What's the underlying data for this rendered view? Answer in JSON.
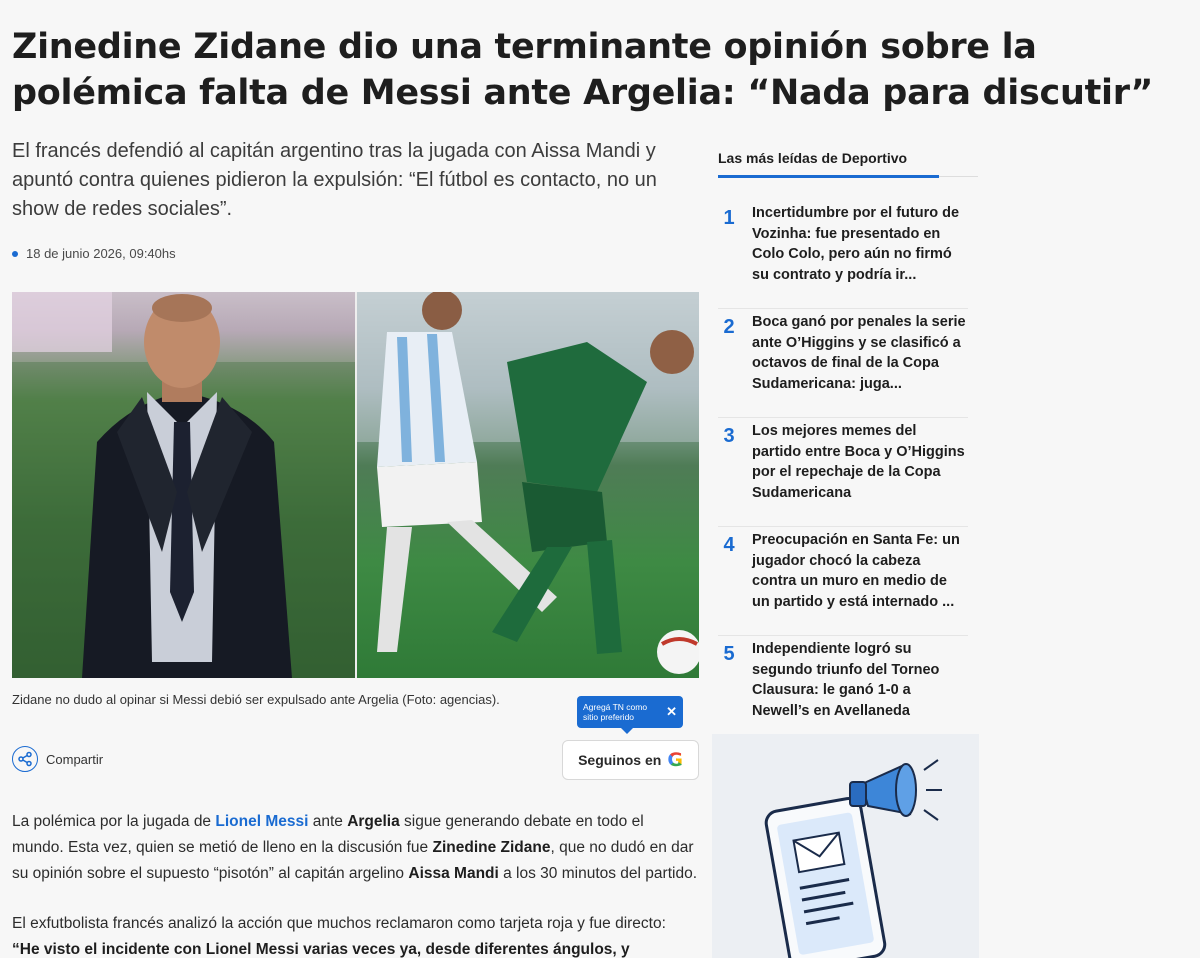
{
  "article": {
    "headline": "Zinedine Zidane dio una terminante opinión sobre la polémica falta de Messi ante Argelia: “Nada para discutir”",
    "subheadline": "El francés defendió al capitán argentino tras la jugada con Aissa Mandi y apuntó contra quienes pidieron la expulsión: “El fútbol es contacto, no un show de redes sociales”.",
    "date": "18 de junio 2026, 09:40hs",
    "caption": "Zidane no dudo al opinar si Messi debió ser expulsado ante Argelia (Foto: agencias).",
    "share_label": "Compartir",
    "follow_label": "Seguinos en",
    "tooltip_text": "Agregá TN como sitio preferido",
    "tooltip_close": "✕",
    "p1": {
      "t1": "La polémica por la jugada de ",
      "link": "Lionel Messi",
      "t2": " ante ",
      "b1": "Argelia",
      "t3": " sigue generando debate en todo el mundo. Esta vez, quien se metió de lleno en la discusión fue ",
      "b2": "Zinedine Zidane",
      "t4": ", que no dudó en dar su opinión sobre el supuesto “pisotón” al capitán argelino ",
      "b3": "Aissa Mandi",
      "t5": " a los 30 minutos del partido."
    },
    "p2": {
      "t1": "El exfutbolista francés analizó la acción que muchos reclamaron como tarjeta roja y fue directo: ",
      "b1": "“He visto el incidente con Lionel Messi varias veces ya, desde diferentes ángulos, y honestamente no"
    }
  },
  "sidebar": {
    "title": "Las más leídas de Deportivo",
    "items": [
      {
        "rank": "1",
        "text": "Incertidumbre por el futuro de Vozinha: fue presentado en Colo Colo, pero aún no firmó su contrato y podría ir..."
      },
      {
        "rank": "2",
        "text": "Boca ganó por penales la serie ante O’Higgins y se clasificó a octavos de final de la Copa Sudamericana: juga..."
      },
      {
        "rank": "3",
        "text": "Los mejores memes del partido entre Boca y O’Higgins por el repechaje de la Copa Sudamericana"
      },
      {
        "rank": "4",
        "text": "Preocupación en Santa Fe: un jugador chocó la cabeza contra un muro en medio de un partido y está internado ..."
      },
      {
        "rank": "5",
        "text": "Independiente logró su segundo triunfo del Torneo Clausura: le ganó 1-0 a Newell’s en Avellaneda"
      }
    ]
  },
  "icons": {
    "share": "share-icon",
    "google": "G",
    "promo": "megaphone-phone-illustration"
  },
  "colors": {
    "accent": "#1a6bd1"
  }
}
